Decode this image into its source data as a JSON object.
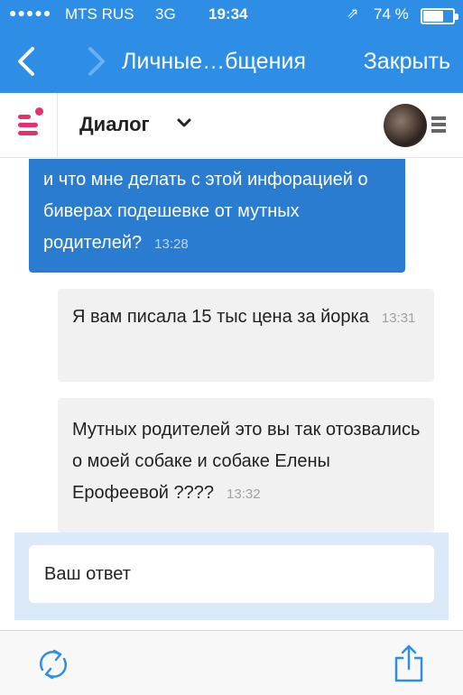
{
  "status_bar": {
    "signal": "●●●●●",
    "carrier": "MTS RUS",
    "network": "3G",
    "time": "19:34",
    "location_glyph": "⇗",
    "battery": "74 %",
    "battery_level": 0.74
  },
  "nav": {
    "title": "Личные…бщения",
    "close_label": "Закрыть"
  },
  "app_header": {
    "title": "Диалог"
  },
  "messages": [
    {
      "direction": "out",
      "text": "и что мне делать с этой инфорацией о биверах подешевке от мутных родителей?",
      "time": "13:28"
    },
    {
      "direction": "in",
      "text": "Я вам писала 15 тыс цена за йорка",
      "time": "13:31"
    },
    {
      "direction": "in",
      "text": "Мутных родителей это вы так отозвались о моей собаке и собаке Елены Ерофеевой ????",
      "time": "13:32"
    }
  ],
  "reply": {
    "placeholder": "Ваш ответ"
  },
  "icons": {
    "back": "chevron-left-icon",
    "forward": "chevron-right-icon",
    "menu": "menu-icon",
    "refresh": "refresh-icon",
    "share": "share-icon",
    "more": "kebab-icon"
  },
  "colors": {
    "nav_blue": "#2e8ee6",
    "outgoing_bubble": "#2a7cd0",
    "incoming_bubble": "#f1f1f1",
    "accent_pink": "#e82e6e",
    "reply_bg": "#daeaf8"
  }
}
